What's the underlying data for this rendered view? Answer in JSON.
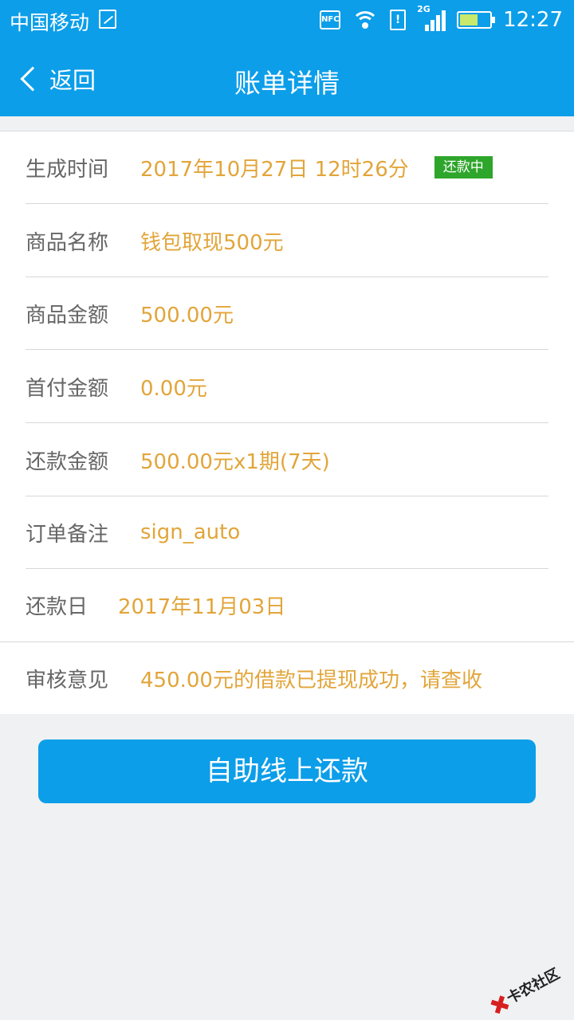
{
  "status_bar": {
    "carrier": "中国移动",
    "nfc": "NFC",
    "sim_label": "!",
    "network": "2G",
    "time": "12:27"
  },
  "header": {
    "back_label": "返回",
    "title": "账单详情"
  },
  "detail": {
    "rows": [
      {
        "label": "生成时间",
        "value": "2017年10月27日 12时26分",
        "badge": "还款中"
      },
      {
        "label": "商品名称",
        "value": "钱包取现500元"
      },
      {
        "label": "商品金额",
        "value": "500.00元"
      },
      {
        "label": "首付金额",
        "value": "0.00元"
      },
      {
        "label": "还款金额",
        "value": "500.00元x1期(7天)"
      },
      {
        "label": "订单备注",
        "value": "sign_auto"
      },
      {
        "label": "还款日",
        "value": "2017年11月03日"
      },
      {
        "label": "审核意见",
        "value": "450.00元的借款已提现成功，请查收"
      }
    ]
  },
  "action": {
    "repay_label": "自助线上还款"
  },
  "watermark": {
    "text": "卡农社区"
  },
  "colors": {
    "brand_blue": "#0c9ee9",
    "value_orange": "#e2a53a",
    "badge_green": "#2ea52b"
  }
}
